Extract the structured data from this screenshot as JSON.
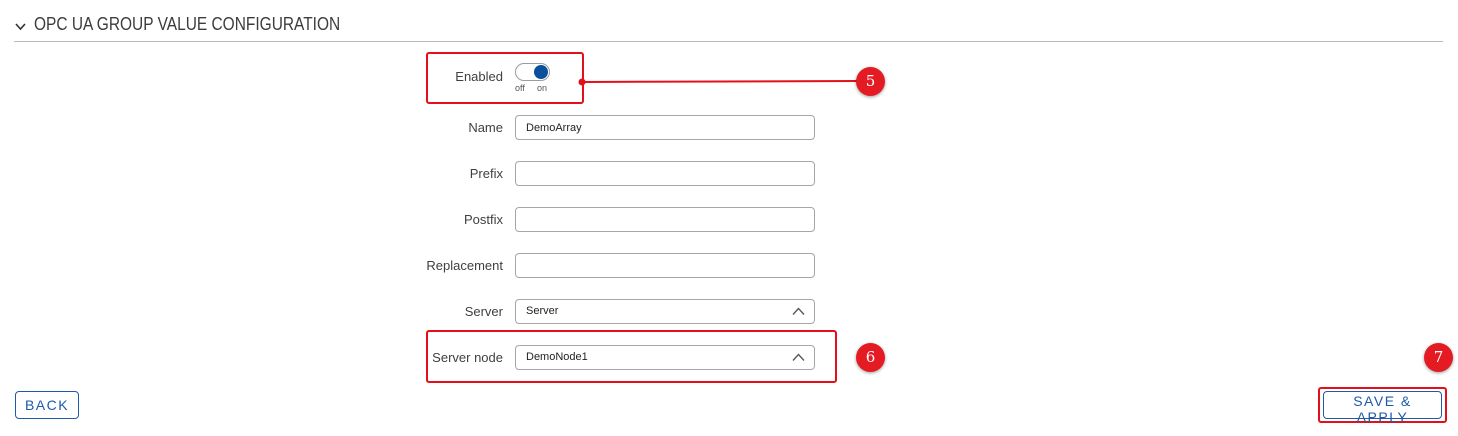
{
  "section": {
    "title": "OPC UA GROUP VALUE CONFIGURATION"
  },
  "form": {
    "enabled": {
      "label": "Enabled",
      "off_label": "off",
      "on_label": "on",
      "state": "on"
    },
    "name": {
      "label": "Name",
      "value": "DemoArray"
    },
    "prefix": {
      "label": "Prefix",
      "value": ""
    },
    "postfix": {
      "label": "Postfix",
      "value": ""
    },
    "replacement": {
      "label": "Replacement",
      "value": ""
    },
    "server": {
      "label": "Server",
      "value": "Server"
    },
    "server_node": {
      "label": "Server node",
      "value": "DemoNode1"
    }
  },
  "annotations": {
    "badge_5": "5",
    "badge_6": "6",
    "badge_7": "7"
  },
  "buttons": {
    "back": "BACK",
    "save_apply": "SAVE & APPLY"
  },
  "colors": {
    "accent": "#1e5aa8",
    "toggle_on": "#0a4f9c",
    "annotation_red": "#e3101a"
  }
}
